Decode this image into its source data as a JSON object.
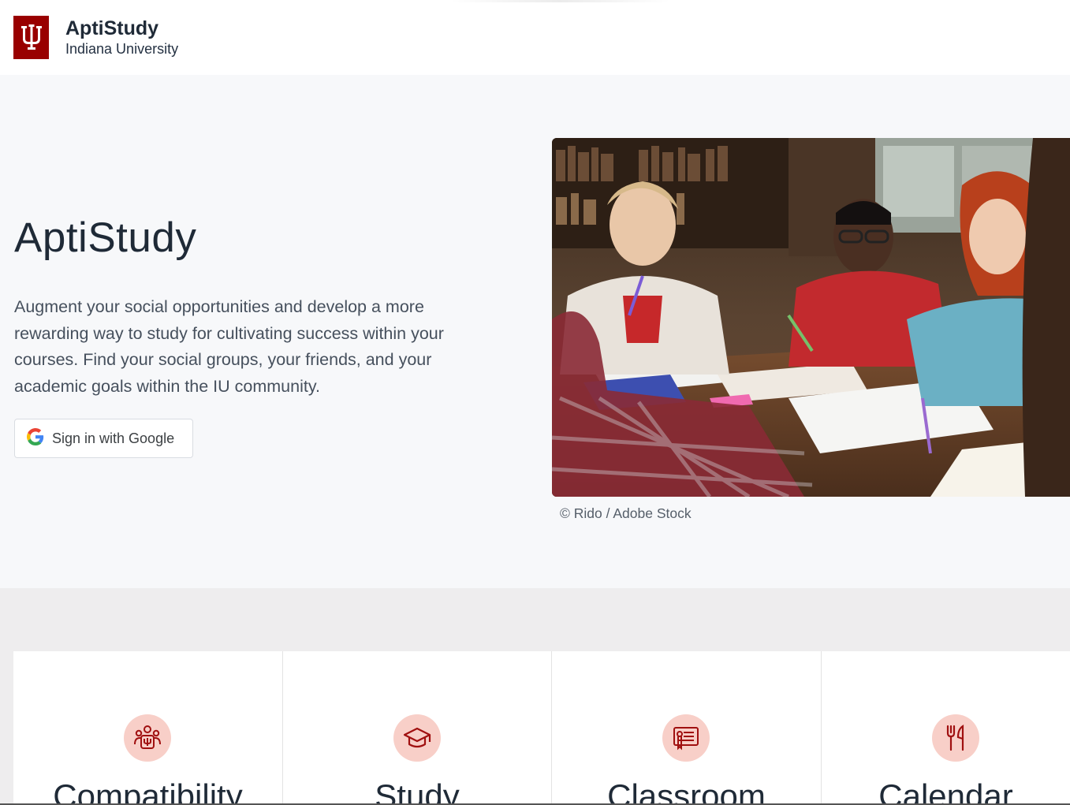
{
  "header": {
    "brand_title": "AptiStudy",
    "brand_subtitle": "Indiana University",
    "logo_icon": "iu-trident-icon"
  },
  "hero": {
    "title": "AptiStudy",
    "description": "Augment your social opportunities and develop a more rewarding way to study for cultivating success within your courses. Find your social groups, your friends, and your academic goals within the IU community.",
    "signin_label": "Sign in with Google",
    "image_credit": "© Rido / Adobe Stock"
  },
  "features": [
    {
      "title": "Compatibility",
      "icon": "group-people-icon"
    },
    {
      "title": "Study",
      "icon": "graduation-cap-icon"
    },
    {
      "title": "Classroom",
      "icon": "certificate-icon"
    },
    {
      "title": "Calendar",
      "icon": "fork-knife-icon"
    }
  ],
  "colors": {
    "brand": "#990000",
    "icon_bg": "#f8cfc8",
    "hero_bg": "#f7f8fa",
    "features_bg": "#eeedee"
  }
}
